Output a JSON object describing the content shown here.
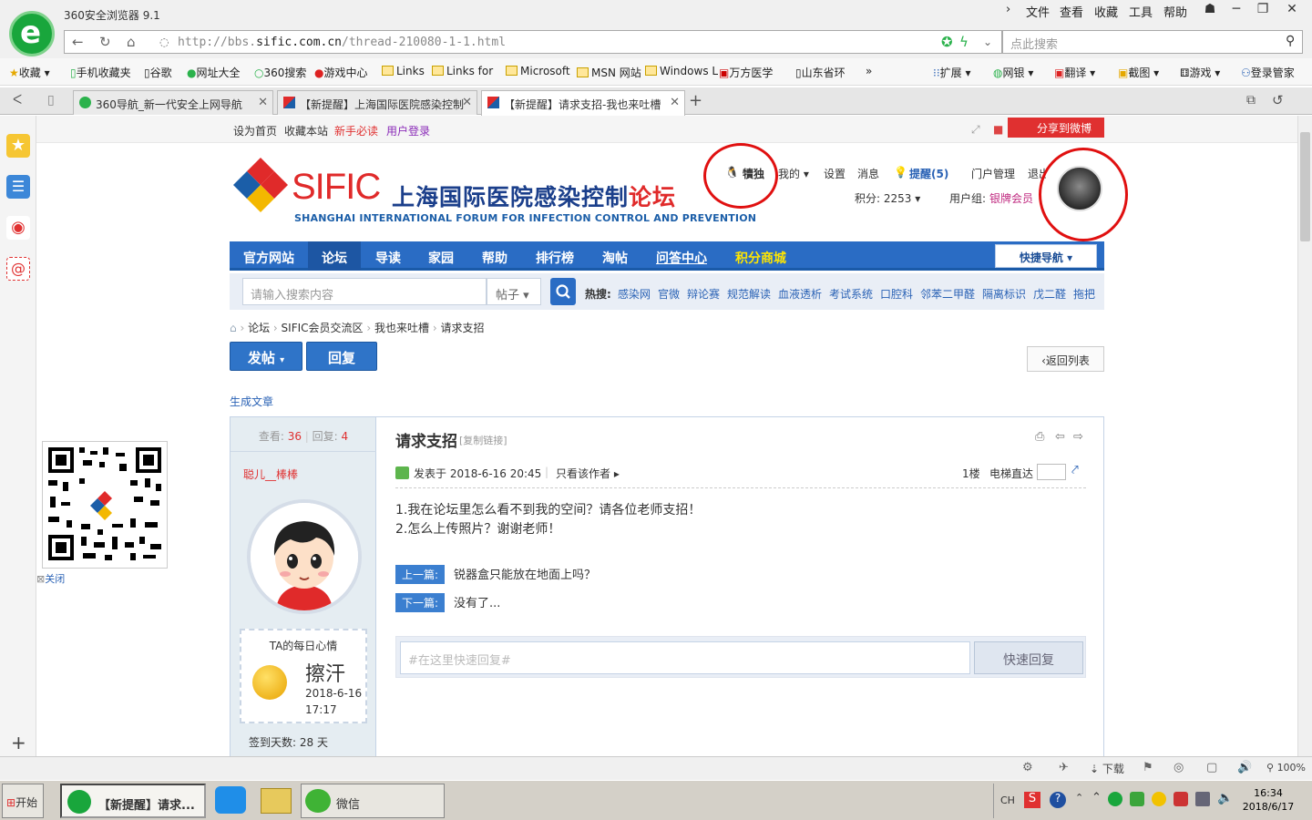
{
  "browser": {
    "app_title": "360安全浏览器 9.1",
    "menu": [
      "文件",
      "查看",
      "收藏",
      "工具",
      "帮助"
    ],
    "url_prefix": "http://bbs.",
    "url_domain": "sific.com.cn",
    "url_suffix": "/thread-210080-1-1.html",
    "search_placeholder": "点此搜索",
    "favorites": [
      "收藏",
      "手机收藏夹",
      "谷歌",
      "网址大全",
      "360搜索",
      "游戏中心",
      "Links",
      "Links for",
      "Microsoft",
      "MSN 网站",
      "Windows L",
      "万方医学",
      "山东省环"
    ],
    "toolbar_right": [
      "扩展",
      "网银",
      "翻译",
      "截图",
      "游戏",
      "登录管家"
    ],
    "tabs": [
      {
        "title": "360导航_新一代安全上网导航"
      },
      {
        "title": "【新提醒】上海国际医院感染控制"
      },
      {
        "title": "【新提醒】请求支招-我也来吐槽"
      }
    ],
    "status_download": "下载",
    "zoom": "100%"
  },
  "page": {
    "top_links": [
      "设为首页",
      "收藏本站",
      "新手必读",
      "用户登录"
    ],
    "share_label": "分享到微博",
    "sific": {
      "brand": "SIFIC",
      "cn_title": "上海国际医院感染控制",
      "cn_title_red": "论坛",
      "en_title": "SHANGHAI INTERNATIONAL FORUM FOR INFECTION CONTROL AND PREVENTION"
    },
    "user": {
      "qq": "犢独",
      "my": "我的",
      "settings": "设置",
      "messages": "消息",
      "reminders": "提醒(5)",
      "portal": "门户管理",
      "logout": "退出",
      "points": "积分: 2253",
      "group_label": "用户组:",
      "group": "银牌会员"
    },
    "nav": [
      "官方网站",
      "论坛",
      "导读",
      "家园",
      "帮助",
      "排行榜",
      "淘帖",
      "问答中心",
      "积分商城"
    ],
    "quick_nav": "快捷导航",
    "search_placeholder": "请输入搜索内容",
    "search_type": "帖子",
    "hot_label": "热搜:",
    "hot": [
      "感染网",
      "官微",
      "辩论赛",
      "规范解读",
      "血液透析",
      "考试系统",
      "口腔科",
      "邻苯二甲醛",
      "隔离标识",
      "戊二醛",
      "拖把"
    ],
    "breadcrumb": [
      "论坛",
      "SIFIC会员交流区",
      "我也来吐槽",
      "请求支招"
    ],
    "post_button": "发帖",
    "reply_button": "回复",
    "back_list": "返回列表",
    "generate": "生成文章",
    "qr_close": "关闭",
    "thread": {
      "views_label": "查看:",
      "views": "36",
      "replies_label": "回复:",
      "replies": "4",
      "author": "聪儿__棒棒",
      "title": "请求支招",
      "copy_link": "[复制链接]",
      "posted": "发表于 2018-6-16 20:45",
      "only_author": "只看该作者",
      "floor": "1楼",
      "elevator": "电梯直达",
      "body": [
        "1.我在论坛里怎么看不到我的空间？请各位老师支招！",
        "2.怎么上传照片？谢谢老师！"
      ],
      "prev_label": "上一篇:",
      "prev": "锐器盒只能放在地面上吗？",
      "next_label": "下一篇:",
      "next": "没有了...",
      "quick_reply_placeholder": "#在这里快速回复#",
      "quick_reply_button": "快速回复",
      "mood_title": "TA的每日心情",
      "mood": "擦汗",
      "mood_date": "2018-6-16",
      "mood_time": "17:17",
      "checkin": "签到天数: 28 天"
    }
  },
  "taskbar": {
    "start": "开始",
    "window": "【新提醒】请求...",
    "wechat": "微信",
    "ime": "CH",
    "time": "16:34",
    "date": "2018/6/17"
  }
}
